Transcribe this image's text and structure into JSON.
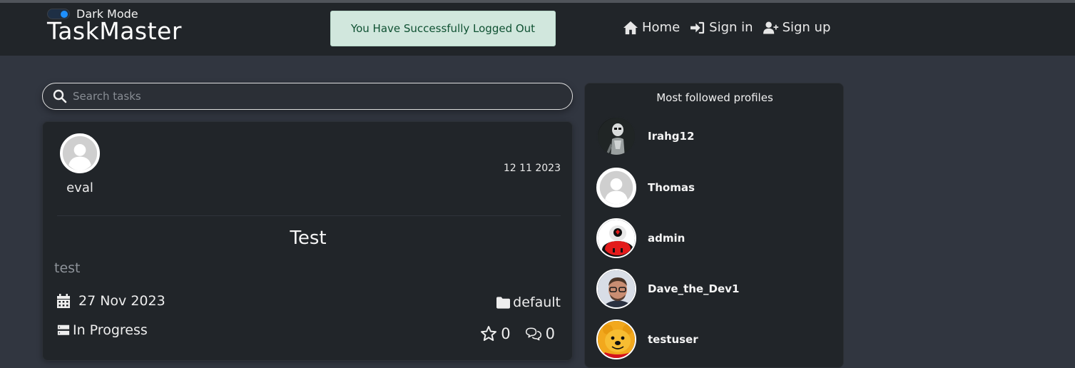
{
  "header": {
    "dark_mode_label": "Dark Mode",
    "brand": "TaskMaster",
    "alert": "You Have Successfully Logged Out",
    "nav": [
      {
        "label": "Home",
        "icon": "home-icon"
      },
      {
        "label": "Sign in",
        "icon": "sign-in-icon"
      },
      {
        "label": "Sign up",
        "icon": "user-plus-icon"
      }
    ]
  },
  "search": {
    "placeholder": "Search tasks",
    "value": ""
  },
  "task": {
    "owner": "eval",
    "created": "12 11 2023",
    "title": "Test",
    "description": "test",
    "due_date": "27 Nov 2023",
    "status": "In Progress",
    "category": "default",
    "stars": "0",
    "comments": "0"
  },
  "sidebar": {
    "title": "Most followed profiles",
    "profiles": [
      {
        "name": "Irahg12",
        "avatar": "stormtrooper-avatar"
      },
      {
        "name": "Thomas",
        "avatar": "default-avatar"
      },
      {
        "name": "admin",
        "avatar": "mushroom-avatar"
      },
      {
        "name": "Dave_the_Dev1",
        "avatar": "man-photo-avatar"
      },
      {
        "name": "testuser",
        "avatar": "bear-avatar"
      }
    ]
  },
  "colors": {
    "navbar": "#212529",
    "page_bg": "#313640",
    "alert_bg": "#d1e7dd",
    "alert_text": "#0f5132",
    "toggle_accent": "#1e90ff"
  }
}
